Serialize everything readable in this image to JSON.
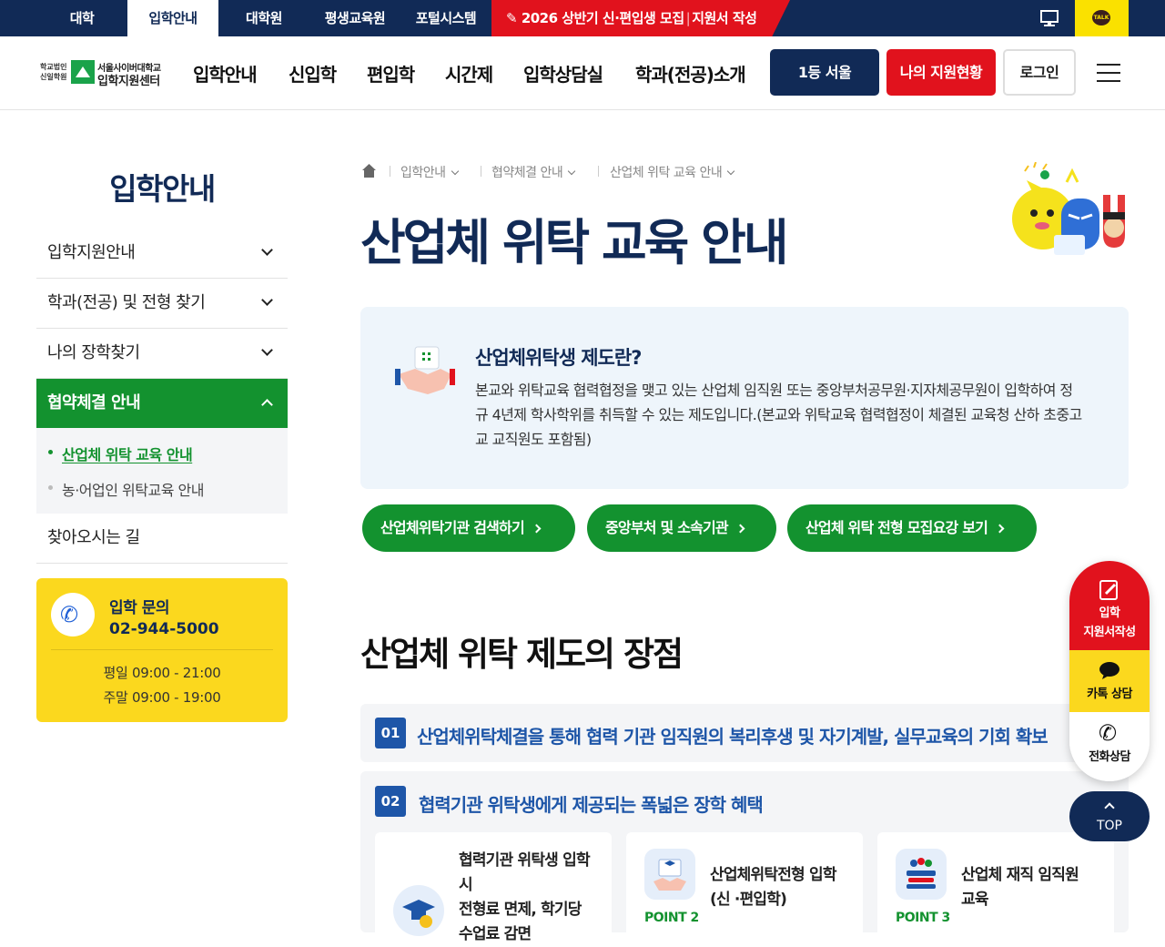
{
  "topbar": {
    "tabs": [
      "대학",
      "입학안내",
      "대학원",
      "평생교육원",
      "포털시스템"
    ],
    "promo": {
      "pen_icon": "pencil-icon",
      "part1": "2026 상반기 신·편입생 모집",
      "part2": "지원서 작성"
    },
    "talk_label": "TALK"
  },
  "header": {
    "logo": {
      "small": "학교법인 신일학원",
      "name1": "서울사이버대학교",
      "name2": "입학지원센터"
    },
    "nav": [
      "입학안내",
      "신입학",
      "편입학",
      "시간제",
      "입학상담실",
      "학과(전공)소개"
    ],
    "btn_navy": "1등 서울",
    "btn_red": "나의 지원현황",
    "btn_login": "로그인"
  },
  "sidebar": {
    "title": "입학안내",
    "items": [
      "입학지원안내",
      "학과(전공) 및 전형 찾기",
      "나의 장학찾기",
      "협약체결 안내",
      "찾아오시는 길"
    ],
    "sub_items": [
      "산업체 위탁 교육 안내",
      "농·어업인 위탁교육 안내"
    ],
    "contact": {
      "label": "입학 문의",
      "phone": "02-944-5000",
      "weekday": "평일 09:00 - 21:00",
      "weekend": "주말 09:00 - 19:00"
    }
  },
  "breadcrumb": [
    "입학안내",
    "협약체결 안내",
    "산업체 위탁 교육 안내"
  ],
  "page_title": "산업체 위탁 교육 안내",
  "intro": {
    "title": "산업체위탁생 제도란?",
    "body": "본교와 위탁교육 협력협정을 맺고 있는 산업체 임직원 또는 중앙부처공무원·지자체공무원이 입학하여 정규 4년제 학사학위를 취득할 수 있는 제도입니다.(본교와 위탁교육 협력협정이 체결된 교육청 산하 초중고교 교직원도 포함됨)"
  },
  "buttons": [
    "산업체위탁기관 검색하기",
    "중앙부처 및 소속기관",
    "산업체 위탁 전형 모집요강 보기"
  ],
  "section_title": "산업체 위탁 제도의 장점",
  "advantages": [
    {
      "no": "01",
      "text": "산업체위탁체결을 통해 협력 기관 임직원의 복리후생 및 자기계발, 실무교육의 기회 확보"
    },
    {
      "no": "02",
      "text": "협력기관 위탁생에게 제공되는 폭넓은 장학 혜택"
    }
  ],
  "cards": [
    {
      "point": "",
      "l1": "협력기관 위탁생 입학",
      "l2": "시",
      "l3": "전형료 면제, 학기당",
      "l4": "수업료 감면"
    },
    {
      "point": "POINT 2",
      "l1": "산업체위탁전형 입학",
      "l2": "(신 ·편입학)"
    },
    {
      "point": "POINT 3",
      "l1": "산업체 재직 임직원",
      "l2": "교육"
    }
  ],
  "floating": {
    "apply_1": "입학",
    "apply_2": "지원서작성",
    "kakao": "카톡 상담",
    "phone": "전화상담",
    "top": "TOP"
  },
  "colors": {
    "navy": "#112a56",
    "red": "#e1121d",
    "green": "#13922f",
    "yellow": "#fbd81e",
    "blue": "#1e56a8"
  }
}
